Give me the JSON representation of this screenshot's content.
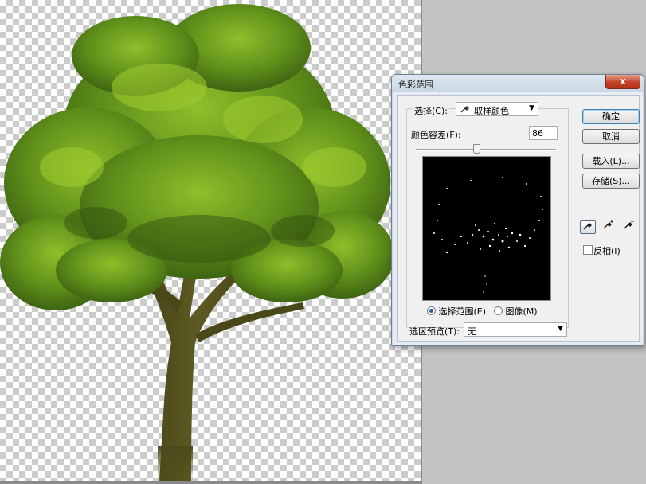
{
  "dialog": {
    "title": "色彩范围",
    "close_label": "x",
    "select_label": "选择(C):",
    "select_value": "取样颜色",
    "fuzziness_label": "颜色容差(F):",
    "fuzziness_value": "86",
    "fuzziness_level": 0.43,
    "radio_selection": "选择范围(E)",
    "radio_image": "图像(M)",
    "preview_label": "选区预览(T):",
    "preview_value": "无",
    "buttons": {
      "ok": "确定",
      "cancel": "取消",
      "load": "载入(L)...",
      "save": "存储(S)..."
    },
    "invert_label": "反相(I)"
  },
  "icons": {
    "eyedropper": "eyedropper-icon",
    "eyedropper_plus": "eyedropper-plus-icon",
    "eyedropper_minus": "eyedropper-minus-icon",
    "dropdown": "chevron-down-icon",
    "close": "close-icon"
  },
  "colors": {
    "checker": "#cccccc",
    "workspace": "#c3c3c3",
    "dialog_bg": "#f0f0f0",
    "close_red": "#c4412a",
    "foliage": "#6f9a1f",
    "trunk": "#4d4a1c"
  }
}
